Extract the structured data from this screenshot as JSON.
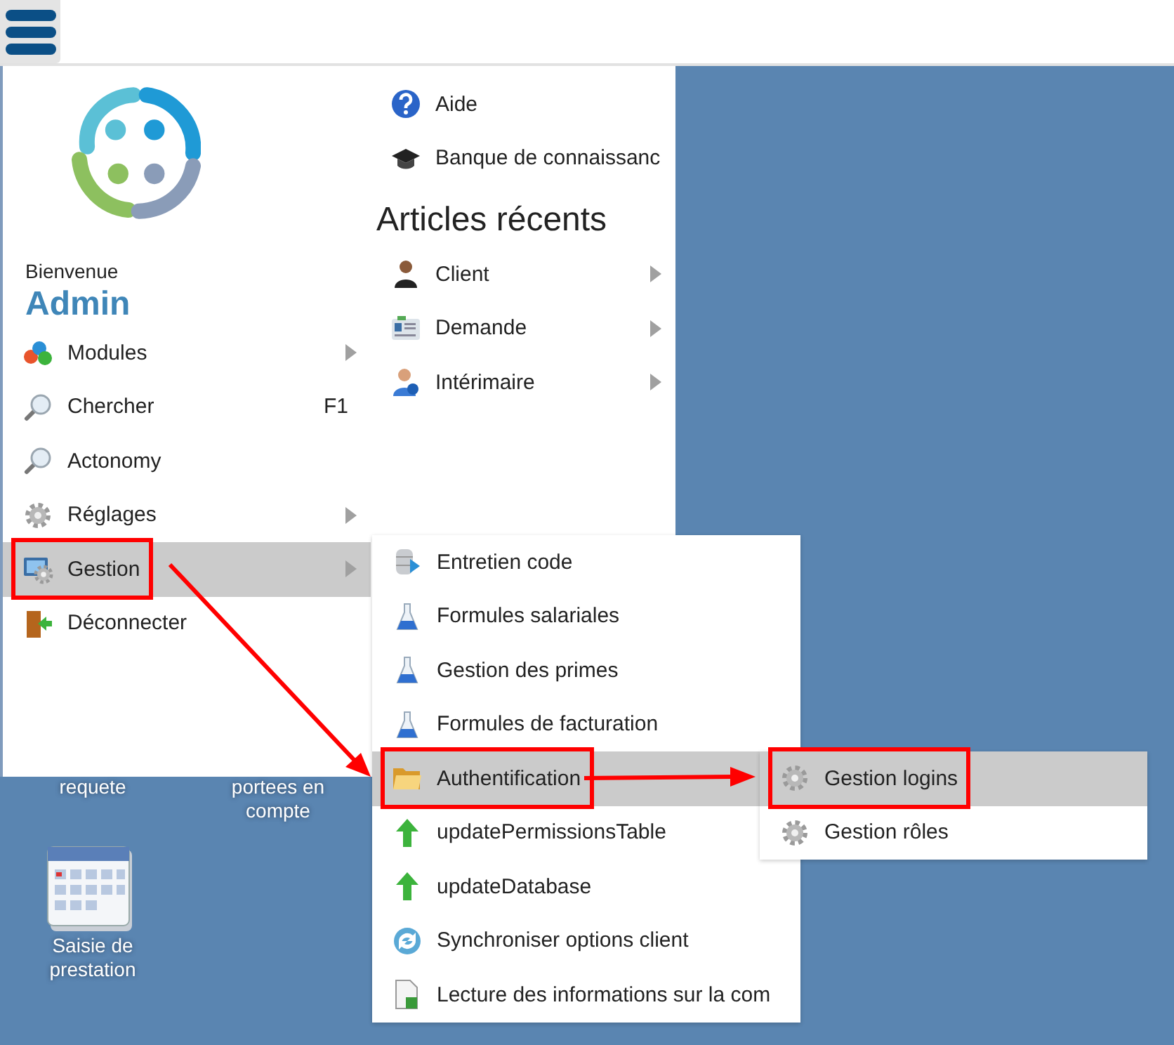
{
  "main_menu": {
    "welcome": "Bienvenue",
    "user": "Admin",
    "items": [
      {
        "label": "Modules",
        "submenu": true,
        "selected": false,
        "highlighted": false
      },
      {
        "label": "Chercher",
        "shortcut": "F1",
        "submenu": false,
        "selected": false,
        "highlighted": false
      },
      {
        "label": "Actonomy",
        "submenu": false,
        "selected": false,
        "highlighted": false
      },
      {
        "label": "Réglages",
        "submenu": true,
        "selected": false,
        "highlighted": false
      },
      {
        "label": "Gestion",
        "submenu": true,
        "selected": true,
        "highlighted": true
      },
      {
        "label": "Déconnecter",
        "submenu": false,
        "selected": false,
        "highlighted": false
      }
    ],
    "links": [
      {
        "label": "Aide"
      },
      {
        "label": "Banque de connaissanc"
      }
    ],
    "recent_heading": "Articles récents",
    "recent": [
      {
        "label": "Client",
        "submenu": true
      },
      {
        "label": "Demande",
        "submenu": true
      },
      {
        "label": "Intérimaire",
        "submenu": true
      }
    ]
  },
  "submenu": {
    "items": [
      {
        "label": "Entretien code",
        "selected": false,
        "highlighted": false
      },
      {
        "label": "Formules salariales",
        "selected": false,
        "highlighted": false
      },
      {
        "label": "Gestion des primes",
        "selected": false,
        "highlighted": false
      },
      {
        "label": "Formules de facturation",
        "selected": false,
        "highlighted": false
      },
      {
        "label": "Authentification",
        "selected": true,
        "highlighted": true
      },
      {
        "label": "updatePermissionsTable",
        "selected": false,
        "highlighted": false
      },
      {
        "label": "updateDatabase",
        "selected": false,
        "highlighted": false
      },
      {
        "label": "Synchroniser options client",
        "selected": false,
        "highlighted": false
      },
      {
        "label": "Lecture des informations sur la com",
        "selected": false,
        "highlighted": false
      }
    ]
  },
  "submenu_2": {
    "items": [
      {
        "label": "Gestion logins",
        "selected": true,
        "highlighted": true
      },
      {
        "label": "Gestion rôles",
        "selected": false,
        "highlighted": false
      }
    ]
  },
  "desktop_icons": [
    {
      "label": "requete"
    },
    {
      "label": "portees en compte"
    },
    {
      "label": "Saisie de prestation"
    }
  ]
}
